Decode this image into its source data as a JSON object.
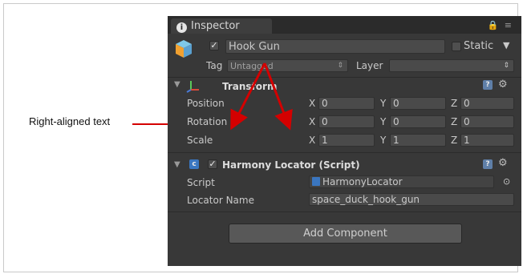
{
  "callout": {
    "text": "Right-aligned text"
  },
  "inspector": {
    "tab_label": "Inspector",
    "object": {
      "enabled": true,
      "name": "Hook Gun",
      "static_label": "Static",
      "static_checked": false
    },
    "tag": {
      "label": "Tag",
      "value": "Untagged"
    },
    "layer": {
      "label": "Layer",
      "value": ""
    },
    "transform": {
      "title": "Transform",
      "rows": [
        {
          "label": "Position",
          "x": "0",
          "y": "0",
          "z": "0"
        },
        {
          "label": "Rotation",
          "x": "0",
          "y": "0",
          "z": "0"
        },
        {
          "label": "Scale",
          "x": "1",
          "y": "1",
          "z": "1"
        }
      ],
      "axes": {
        "x": "X",
        "y": "Y",
        "z": "Z"
      }
    },
    "harmony": {
      "title": "Harmony Locator (Script)",
      "script_label": "Script",
      "script_value": "HarmonyLocator",
      "locator_label": "Locator Name",
      "locator_value": "space_duck_hook_gun"
    },
    "add_component": "Add Component"
  },
  "colors": {
    "panel": "#383838",
    "arrow": "#d40000"
  }
}
